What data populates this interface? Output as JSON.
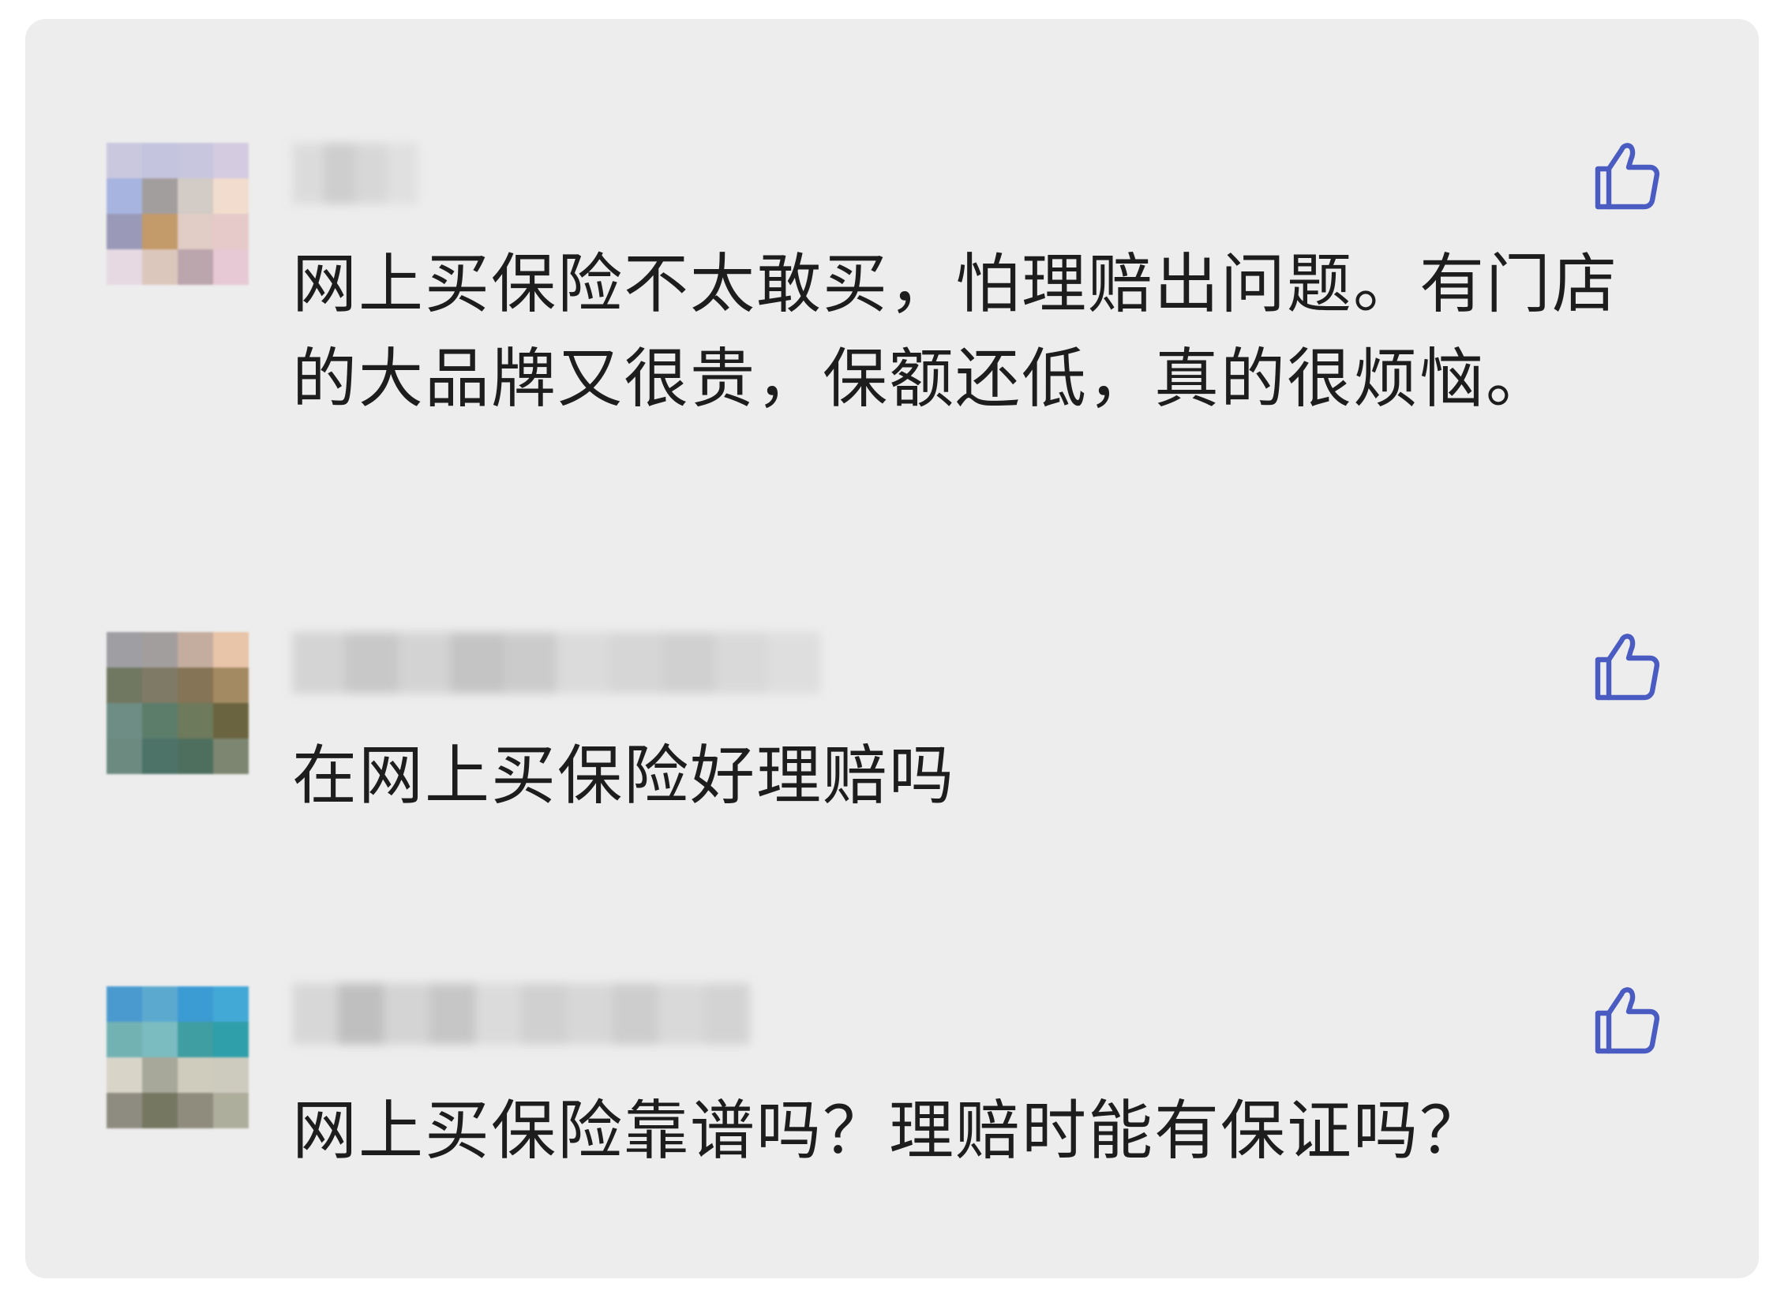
{
  "comments": [
    {
      "avatar_colors": [
        "#c9c8df",
        "#c4c4df",
        "#c8c6de",
        "#d4cbe0",
        "#a7b4e0",
        "#a39e9e",
        "#d2cbc6",
        "#f1dccd",
        "#9a9ab8",
        "#c39a6a",
        "#e1ccc6",
        "#e6c9c9",
        "#e6d9e2",
        "#dcc7bd",
        "#bca6ad",
        "#e6c9d4"
      ],
      "username_blocks": [
        "#d9d9d9",
        "#c9c9c9",
        "#d4d4d4",
        "#dedede"
      ],
      "text": "网上买保险不太敢买，怕理赔出问题。有门店的大品牌又很贵，保额还低，真的很烦恼。",
      "like_icon": "thumbs-up-icon"
    },
    {
      "avatar_colors": [
        "#9e9ea3",
        "#a39e9e",
        "#c4ad9e",
        "#e8c4a8",
        "#707862",
        "#7f7a66",
        "#857455",
        "#a38a62",
        "#6e8d85",
        "#5b7d6a",
        "#6d7a5b",
        "#6b6440",
        "#6c8a80",
        "#4d7369",
        "#4f6f5e",
        "#7c8670"
      ],
      "username_blocks": [
        "#d0d0d0",
        "#c2c2c2",
        "#cfcfcf",
        "#bdbdbd",
        "#c6c6c6",
        "#d8d8d8",
        "#d2d2d2",
        "#cccccc",
        "#d6d6d6",
        "#dcdcdc"
      ],
      "text": "在网上买保险好理赔吗",
      "like_icon": "thumbs-up-icon"
    },
    {
      "avatar_colors": [
        "#4a9ad0",
        "#5ca9cf",
        "#3b9bd3",
        "#42a8d6",
        "#72b2b3",
        "#7bbcc1",
        "#3f9ea1",
        "#2f9fa9",
        "#d8d4c8",
        "#a8a89a",
        "#cfcbbd",
        "#cdcabe",
        "#8e8c80",
        "#757761",
        "#8f8c7e",
        "#aeae9c"
      ],
      "username_blocks": [
        "#d4d4d4",
        "#b8b8b8",
        "#d0d0d0",
        "#c0c0c0",
        "#d8d8d8",
        "#cccccc",
        "#d4d4d4",
        "#c8c8c8",
        "#d6d6d6",
        "#cfcfcf"
      ],
      "text": "网上买保险靠谱吗？理赔时能有保证吗？",
      "like_icon": "thumbs-up-icon"
    }
  ]
}
